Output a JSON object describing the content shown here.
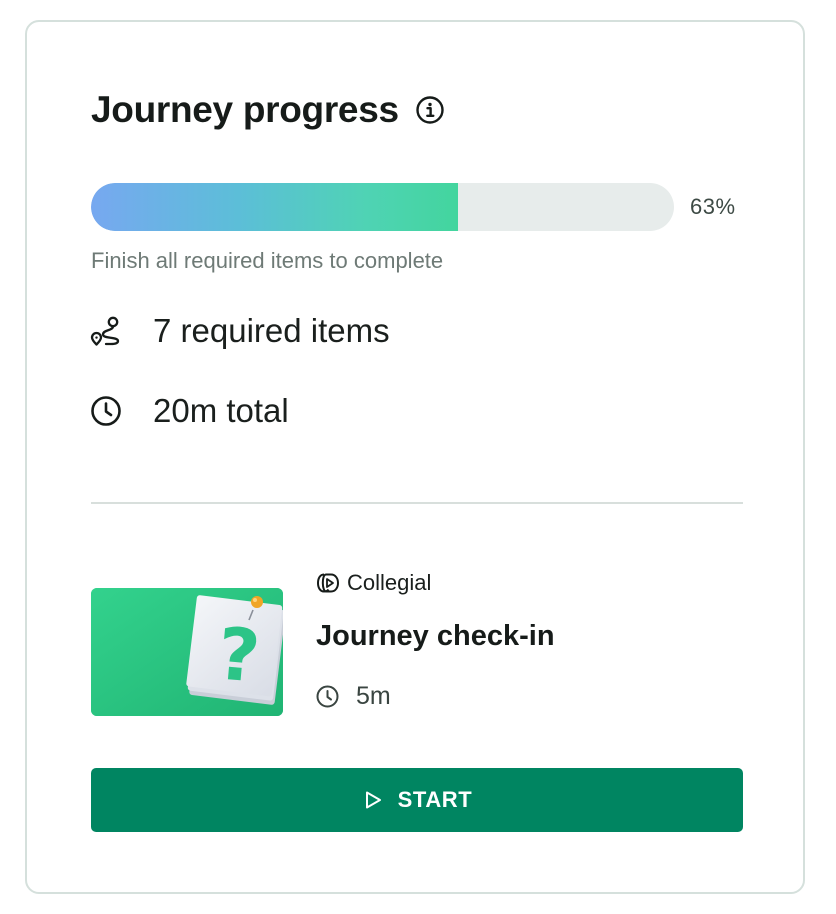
{
  "card": {
    "title": "Journey progress",
    "title_icon": "info-icon",
    "progress": {
      "percent_value": 63,
      "percent_label": "63%",
      "hint": "Finish all required items to complete"
    },
    "meta": [
      {
        "icon": "route-icon",
        "text": "7 required items"
      },
      {
        "icon": "clock-icon",
        "text": "20m total"
      }
    ]
  },
  "next_item": {
    "thumbnail_icon": "question-mark-note-icon",
    "provider": {
      "icon": "collegial-logo-icon",
      "name": "Collegial"
    },
    "title": "Journey check-in",
    "duration": {
      "icon": "clock-icon",
      "text": "5m"
    }
  },
  "start_button": {
    "icon": "play-icon",
    "label": "START"
  },
  "colors": {
    "accent_button": "#008561",
    "progress_start": "#77a8f0",
    "progress_end": "#43d59e",
    "progress_track": "#e7eceb",
    "thumbnail_bg": "#25c27d"
  }
}
